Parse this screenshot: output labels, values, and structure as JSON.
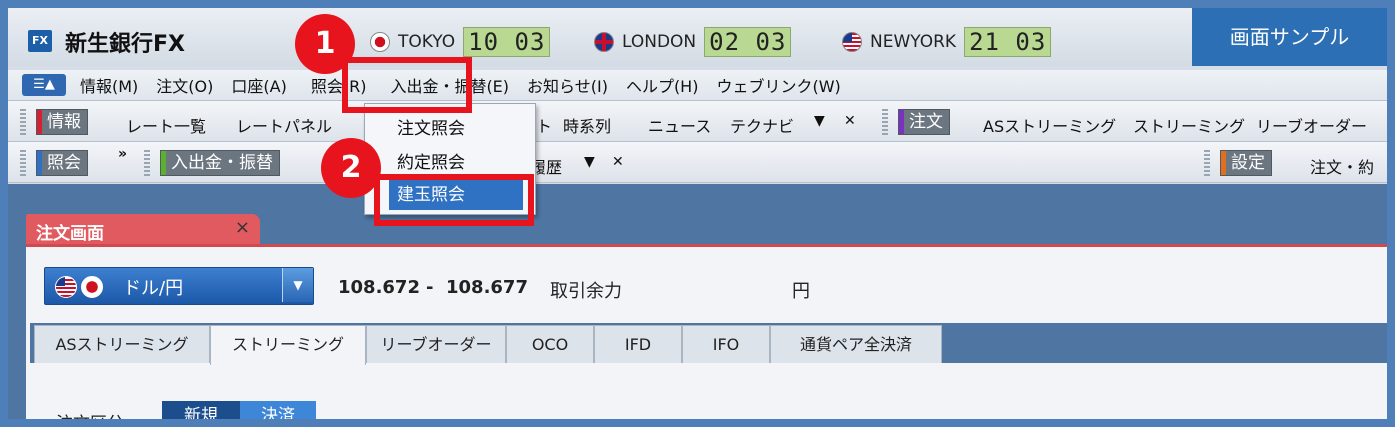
{
  "app": {
    "title": "新生銀行FX",
    "logo": "FX",
    "sample_badge": "画面サンプル"
  },
  "clocks": [
    {
      "city": "TOKYO",
      "time": "10 03",
      "flag": "jp-flag-icon"
    },
    {
      "city": "LONDON",
      "time": "02 03",
      "flag": "uk-flag-icon"
    },
    {
      "city": "NEWYORK",
      "time": "21 03",
      "flag": "us-flag-icon"
    }
  ],
  "menu": {
    "items": [
      "情報(M)",
      "注文(O)",
      "口座(A)",
      "照会(R)",
      "入出金・振替(E)",
      "お知らせ(I)",
      "ヘルプ(H)",
      "ウェブリンク(W)"
    ]
  },
  "toolbar1": {
    "info_tag": "情報",
    "info_items": [
      "レート一覧",
      "レートパネル"
    ],
    "hidden_tail": "ト",
    "more_items": [
      "時系列",
      "ニュース",
      "テクナビ"
    ],
    "order_tag": "注文",
    "order_items": [
      "ASストリーミング",
      "ストリーミング",
      "リーブオーダー"
    ]
  },
  "toolbar2": {
    "inquiry_tag": "照会",
    "deposit_tag": "入出金・振替",
    "history_tail": "履歴",
    "settings_tag": "設定",
    "settings_items": [
      "注文・約"
    ]
  },
  "dropdown": {
    "items": [
      "注文照会",
      "約定照会",
      "建玉照会"
    ],
    "selected": "建玉照会"
  },
  "steps": [
    "1",
    "2"
  ],
  "order_panel": {
    "tab_title": "注文画面",
    "close": "×",
    "pair": "ドル/円",
    "bid": "108.672",
    "separator": "-",
    "ask": "108.677",
    "margin_label": "取引余力",
    "unit": "円",
    "tabs": [
      "ASストリーミング",
      "ストリーミング",
      "リーブオーダー",
      "OCO",
      "IFD",
      "IFO",
      "通貨ペア全決済"
    ],
    "active_tab": "ストリーミング",
    "order_type_label": "注文区分:",
    "order_types": [
      "新規",
      "決済"
    ],
    "selected_order_type": "決済"
  },
  "colors": {
    "frame": "#4f7fb8",
    "highlight": "#e8141d",
    "selected": "#2f72c4",
    "tab_red": "#e05a60"
  }
}
